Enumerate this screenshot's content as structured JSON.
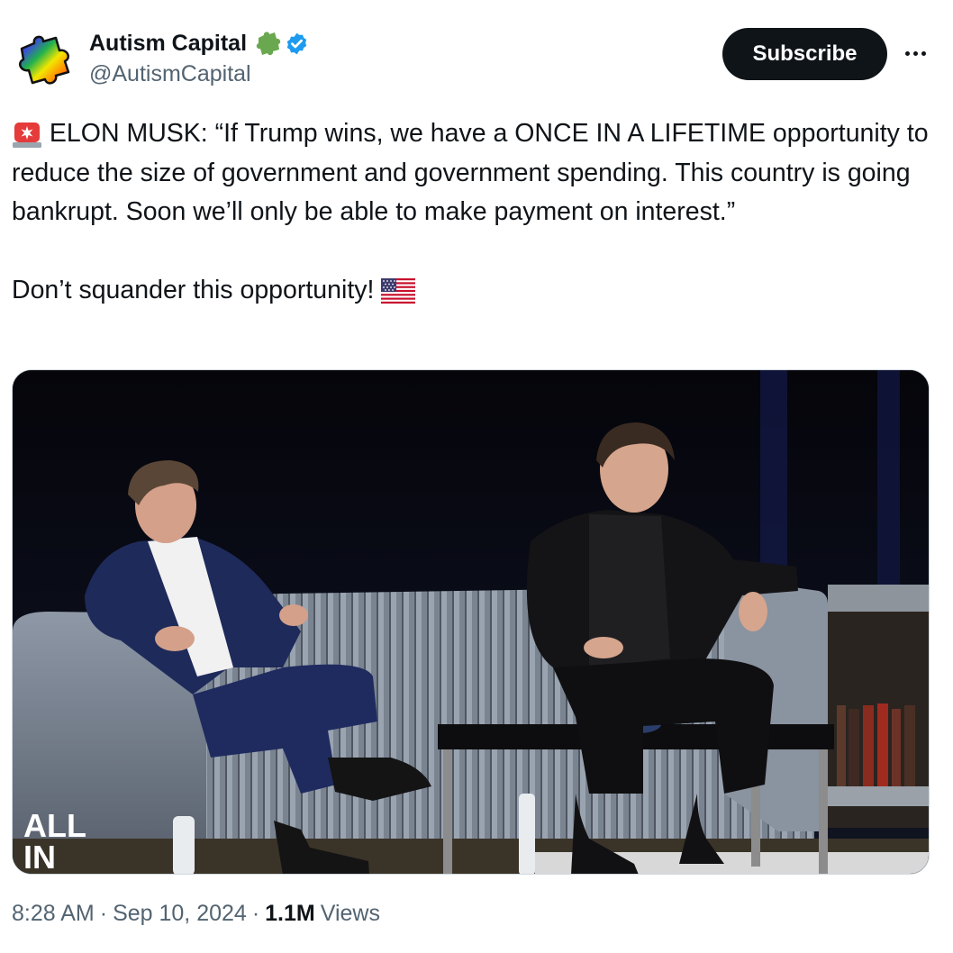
{
  "author": {
    "display_name": "Autism Capital",
    "handle": "@AutismCapital",
    "avatar_icon": "rainbow-puzzle-piece-icon",
    "badges": [
      "green-puzzle-piece-icon",
      "verified-badge-icon"
    ]
  },
  "actions": {
    "subscribe_label": "Subscribe",
    "more_icon": "more-options-icon"
  },
  "tweet": {
    "line1": "ELON MUSK: “If Trump wins, we have a ONCE IN A LIFETIME opportunity to reduce the size of government and government spending. This country is going bankrupt. Soon we’ll only be able to make payment on interest.”",
    "line2": "Don’t squander this opportunity!",
    "lead_emoji": "police-siren-icon",
    "trail_emoji": "us-flag-icon"
  },
  "media": {
    "watermark_line1": "ALL",
    "watermark_line2": "IN"
  },
  "meta": {
    "time": "8:28 AM",
    "date": "Sep 10, 2024",
    "views_count": "1.1M",
    "views_label": "Views",
    "separator": "·"
  },
  "colors": {
    "text": "#0f1419",
    "secondary": "#536471",
    "verified": "#1d9bf0",
    "button_bg": "#0f1419"
  }
}
